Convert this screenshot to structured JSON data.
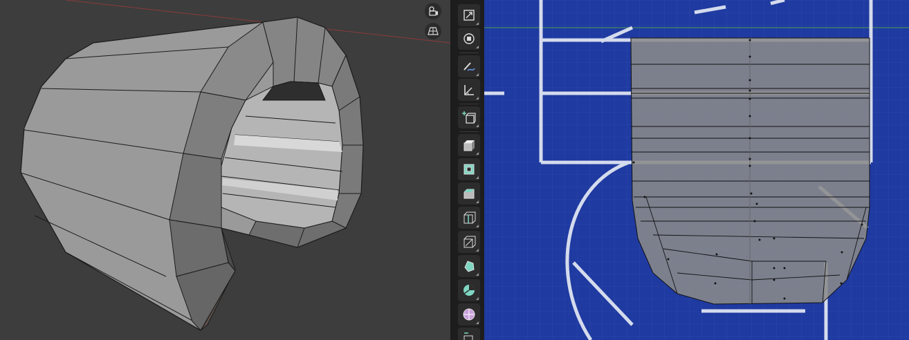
{
  "left_viewport": {
    "nav_gizmos": [
      {
        "icon": "camera-view-icon"
      },
      {
        "icon": "perspective-grid-icon"
      }
    ]
  },
  "right_viewport": {
    "toolbar": {
      "tools": [
        {
          "icon": "scale-icon",
          "active": false
        },
        {
          "icon": "transform-icon",
          "active": false
        },
        {
          "icon": "annotate-icon",
          "active": false
        },
        {
          "icon": "measure-icon",
          "active": false
        },
        {
          "icon": "add-cube-icon",
          "active": false
        },
        {
          "icon": "extrude-region-icon",
          "active": false
        },
        {
          "icon": "inset-faces-icon",
          "active": false
        },
        {
          "icon": "bevel-icon",
          "active": false
        },
        {
          "icon": "loop-cut-icon",
          "active": false
        },
        {
          "icon": "knife-icon",
          "active": false
        },
        {
          "icon": "poly-build-icon",
          "active": false
        },
        {
          "icon": "spin-icon",
          "active": false
        },
        {
          "icon": "smooth-icon",
          "active": false
        },
        {
          "icon": "edge-slide-icon",
          "active": false
        }
      ]
    }
  },
  "colors": {
    "viewport_bg": "#3d3d3d",
    "mesh_face": "#9c9c9c",
    "blueprint_bg": "#1f3aa0",
    "toolbar_bg": "#1d1d1d",
    "teal_icon": "#7fd6c2"
  }
}
